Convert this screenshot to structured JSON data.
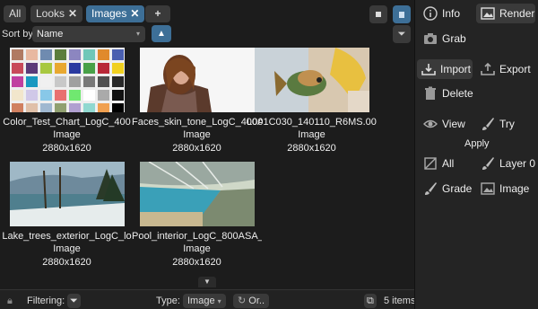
{
  "tabs": [
    {
      "label": "All",
      "closable": false,
      "active": false
    },
    {
      "label": "Looks",
      "closable": true,
      "active": false
    },
    {
      "label": "Images",
      "closable": true,
      "active": true
    },
    {
      "label": "+",
      "closable": false,
      "active": false
    }
  ],
  "sort": {
    "label": "Sort by",
    "value": "Name",
    "direction_icon": "triangle-up"
  },
  "items": [
    {
      "name": "Color_Test_Chart_LogC_400",
      "type": "Image",
      "size": "2880x1620"
    },
    {
      "name": "Faces_skin_tone_LogC_400A",
      "type": "Image",
      "size": "2880x1620"
    },
    {
      "name": "L001C030_140110_R6MS.00",
      "type": "Image",
      "size": "2880x1620"
    },
    {
      "name": "Lake_trees_exterior_LogC_lo",
      "type": "Image",
      "size": "2880x1620"
    },
    {
      "name": "Pool_interior_LogC_800ASA_",
      "type": "Image",
      "size": "2880x1620"
    }
  ],
  "bottom": {
    "filtering_label": "Filtering:",
    "type_label": "Type:",
    "type_value": "Image",
    "or_label": "Or..",
    "count": "5 items"
  },
  "panel": {
    "info": "Info",
    "render": "Render",
    "grab": "Grab",
    "import": "Import",
    "export": "Export",
    "delete": "Delete",
    "view": "View",
    "try": "Try",
    "apply": "Apply",
    "all": "All",
    "layer": "Layer 0",
    "grade": "Grade",
    "image": "Image"
  },
  "colors": {
    "accent": "#3d6f97",
    "background": "#1c1c1c",
    "panel": "#242424",
    "button": "#3a3a3a"
  }
}
